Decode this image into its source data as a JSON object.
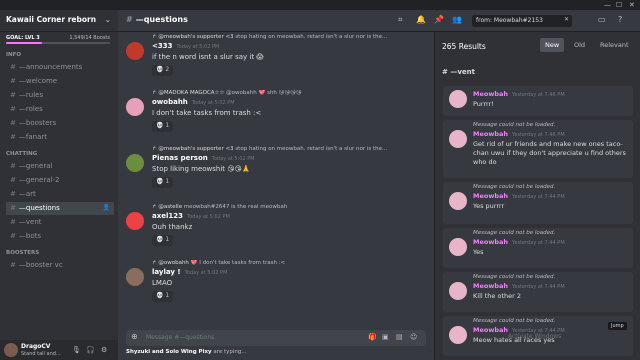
{
  "server": {
    "name": "Kawaii Corner reborn",
    "goal_label": "GOAL: LVL 3",
    "boosts": "1,549/14 Boosts",
    "progress_fraction": 0.35
  },
  "categories": {
    "info": "INFO",
    "chatting": "CHATTING",
    "boosters": "BOOSTERS"
  },
  "channels_info": [
    {
      "name": "—announcements"
    },
    {
      "name": "—welcome"
    },
    {
      "name": "—rules"
    },
    {
      "name": "—roles"
    },
    {
      "name": "—boosters"
    },
    {
      "name": "—fanart"
    }
  ],
  "channels_chat": [
    {
      "name": "—general"
    },
    {
      "name": "—general-2"
    },
    {
      "name": "—art"
    },
    {
      "name": "—questions"
    },
    {
      "name": "—vent"
    },
    {
      "name": "—bots"
    }
  ],
  "channels_boost": [
    {
      "name": "—booster vc"
    }
  ],
  "user": {
    "name": "DragoCV",
    "status": "Stand tall and..."
  },
  "topbar": {
    "channel": "—questions",
    "search_value": "from: Meowbah#2153"
  },
  "messages": [
    {
      "reply_name": "@meowbah's supporter <3",
      "reply_text": "stop hating on meowbah. retard isn't a slur nor is the...",
      "name": "<333",
      "time": "Today at 5:02 PM",
      "text": "if the n word isnt a slur say it 😱",
      "reaction": "💀 2"
    },
    {
      "reply_name": "@MADOKA MAGOCA☆☆",
      "reply_text": "@owobahh 💖 shh 😘😘😘😘",
      "name": "owobahh",
      "time": "Today at 5:02 PM",
      "text": "I don't take tasks from trash :<",
      "reaction": "💀 1"
    },
    {
      "reply_name": "@meowbah's supporter <3",
      "reply_text": "stop hating on meowbah. retard isn't a slur nor is the...",
      "name": "Pienas person",
      "time": "Today at 5:02 PM",
      "text": "Stop liking meowshit 😘😘🙏",
      "reaction": "💀 1"
    },
    {
      "reply_name": "@astelle",
      "reply_text": "meowbah#2647 is the real meowbah",
      "name": "axel123",
      "time": "Today at 5:02 PM",
      "text": "Ouh thankz",
      "reaction": "💀 1"
    },
    {
      "reply_name": "@owobahh",
      "reply_text": "💖 I don't take tasks from trash :<",
      "name": "laylay !",
      "time": "Today at 5:02 PM",
      "text": "LMAO",
      "reaction": "💀 1"
    }
  ],
  "composer": {
    "placeholder": "Message #—questions"
  },
  "typing": {
    "users": "Shyzuki and Solo Wing Pixy",
    "suffix": " are typing..."
  },
  "results": {
    "count": "265 Results",
    "tabs": [
      "New",
      "Old",
      "Relevant"
    ],
    "channel": "—vent",
    "not_loaded": "Message could not be loaded.",
    "items": [
      {
        "name": "Meowbah",
        "time": "Yesterday at 7:46 PM",
        "text": "Purrrr!"
      },
      {
        "name": "Meowbah",
        "time": "Yesterday at 7:46 PM",
        "text": "Get rid of ur friends and make new ones taco-chan uwu if they don't appreciate u find others who do"
      },
      {
        "name": "Meowbah",
        "time": "Yesterday at 7:44 PM",
        "text": "Yes purrrr"
      },
      {
        "name": "Meowbah",
        "time": "Yesterday at 7:44 PM",
        "text": "Yes"
      },
      {
        "name": "Meowbah",
        "time": "Yesterday at 7:44 PM",
        "text": "Kill the other 2"
      },
      {
        "name": "Meowbah",
        "time": "Yesterday at 7:44 PM",
        "text": "Meow hates all races yes"
      }
    ],
    "jump": "Jump",
    "watermark": "Activate Windows"
  },
  "colors": {
    "accent": "#5865f2",
    "meowbah": "#f47fff",
    "background": "#36393f"
  }
}
